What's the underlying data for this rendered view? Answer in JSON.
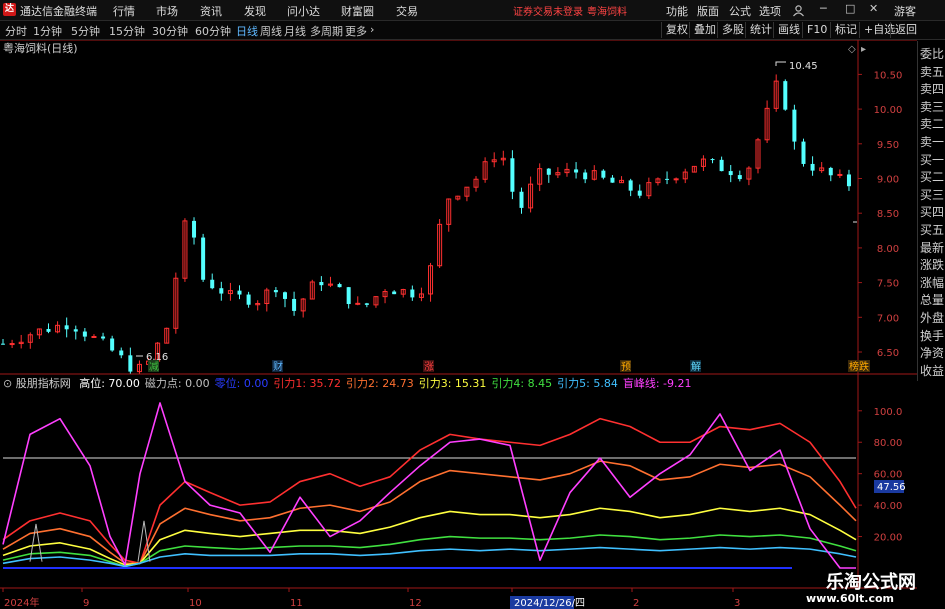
{
  "titlebar": {
    "app_name": "通达信金融终端",
    "menus": [
      "行情",
      "市场",
      "资讯",
      "发现",
      "问小达",
      "财富圈",
      "交易"
    ],
    "warning": "证券交易未登录",
    "stock": "粤海饲料",
    "right_menus": [
      "功能",
      "版面",
      "公式",
      "选项"
    ],
    "guest": "游客"
  },
  "toolbar": {
    "periods": [
      "分时",
      "1分钟",
      "5分钟",
      "15分钟",
      "30分钟",
      "60分钟",
      "日线",
      "周线",
      "月线",
      "多周期",
      "更多"
    ],
    "active_period": "日线",
    "right_buttons": [
      "复权",
      "叠加",
      "多股",
      "统计",
      "画线",
      "F10",
      "标记",
      "+自选",
      "返回"
    ]
  },
  "main_chart": {
    "title": "粤海饲料(日线)",
    "high_label": "10.45",
    "low_label": "6.16",
    "y_ticks": [
      "10.50",
      "10.00",
      "9.50",
      "9.00",
      "8.50",
      "8.00",
      "7.50",
      "7.00",
      "6.50"
    ],
    "event_markers": [
      {
        "text": "减",
        "color": "#3fbf3f"
      },
      {
        "text": "财",
        "color": "#5fb8ff"
      },
      {
        "text": "涨",
        "color": "#ff4040"
      },
      {
        "text": "预",
        "color": "#ffaa00"
      },
      {
        "text": "解",
        "color": "#5fd8ff"
      },
      {
        "text": "榜跌",
        "color": "#ffaa00"
      }
    ]
  },
  "sidebar": {
    "items": [
      "委比",
      "卖五",
      "卖四",
      "卖三",
      "卖二",
      "卖一",
      "买一",
      "买二",
      "买三",
      "买四",
      "买五",
      "最新",
      "涨跌",
      "涨幅",
      "总量",
      "外盘",
      "换手",
      "净资",
      "收益"
    ]
  },
  "indicator": {
    "name": "股朋指标网",
    "items": [
      {
        "label": "高位",
        "value": "70.00",
        "color": "#ffffff"
      },
      {
        "label": "磁力点",
        "value": "0.00",
        "color": "#c0c0c0"
      },
      {
        "label": "零位",
        "value": "0.00",
        "color": "#2a3cff"
      },
      {
        "label": "引力1",
        "value": "35.72",
        "color": "#ff3030"
      },
      {
        "label": "引力2",
        "value": "24.73",
        "color": "#ff7030"
      },
      {
        "label": "引力3",
        "value": "15.31",
        "color": "#ffff40"
      },
      {
        "label": "引力4",
        "value": "8.45",
        "color": "#40e040"
      },
      {
        "label": "引力5",
        "value": "5.84",
        "color": "#40c0ff"
      },
      {
        "label": "盲峰线",
        "value": "-9.21",
        "color": "#ff40ff"
      }
    ],
    "y_ticks": [
      "100.0",
      "80.00",
      "60.00",
      "40.00",
      "20.00"
    ],
    "current_value": "47.56"
  },
  "date_axis": {
    "labels": [
      "2024年",
      "9",
      "10",
      "11",
      "12",
      "2024/12/26/四",
      "2",
      "3"
    ]
  },
  "watermark": {
    "title": "乐淘公式网",
    "url": "www.60lt.com"
  }
}
